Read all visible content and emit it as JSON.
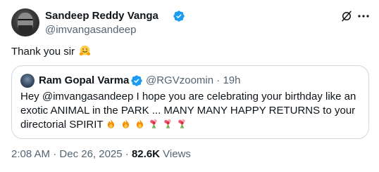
{
  "author": {
    "name": "Sandeep Reddy Vanga",
    "handle": "@imvangasandeep"
  },
  "tweet": {
    "text": "Thank you sir"
  },
  "quote": {
    "name": "Ram Gopal Varma",
    "handle": "@RGVzoomin",
    "separator": "·",
    "age": "19h",
    "text": "Hey @imvangasandeep I hope you are celebrating your birthday like an exotic ANIMAL in the PARK ... MANY MANY HAPPY RETURNS to your directorial SPIRIT"
  },
  "footer": {
    "time": "2:08 AM",
    "separator1": "·",
    "date": "Dec 26, 2025",
    "separator2": "·",
    "views_count": "82.6K",
    "views_label": "Views"
  },
  "colors": {
    "text": "#0f1419",
    "secondary": "#536471",
    "verified": "#1d9bf0",
    "border": "#cfd9de"
  },
  "icons": [
    "grok-icon",
    "more-icon",
    "verified-badge-icon",
    "hugging-face-emoji",
    "fire-emoji",
    "bouquet-emoji"
  ]
}
